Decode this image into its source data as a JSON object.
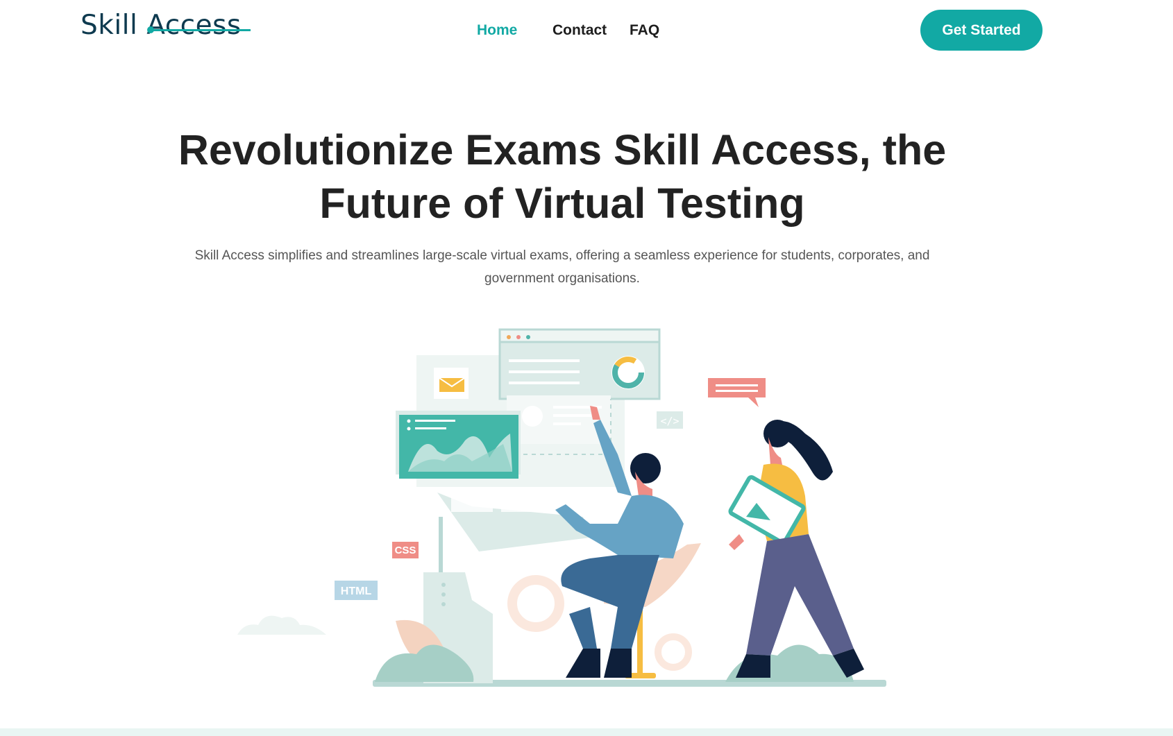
{
  "brand": {
    "logo_text": "Skill Access",
    "accent_color": "#12a9a4",
    "logo_color": "#0e3a4f"
  },
  "nav": {
    "items": [
      {
        "label": "Home",
        "active": true
      },
      {
        "label": "Contact",
        "active": false
      },
      {
        "label": "FAQ",
        "active": false
      }
    ]
  },
  "cta": {
    "label": "Get Started"
  },
  "hero": {
    "title_line1": "Revolutionize Exams Skill Access, the",
    "title_line2": "Future of Virtual Testing",
    "subtitle_line1": "Skill Access simplifies and streamlines large-scale virtual exams, offering a seamless experience for students, corporates, and",
    "subtitle_line2": "government organisations."
  },
  "illustration": {
    "tags": {
      "css": "CSS",
      "html": "HTML",
      "code": "</>"
    }
  }
}
